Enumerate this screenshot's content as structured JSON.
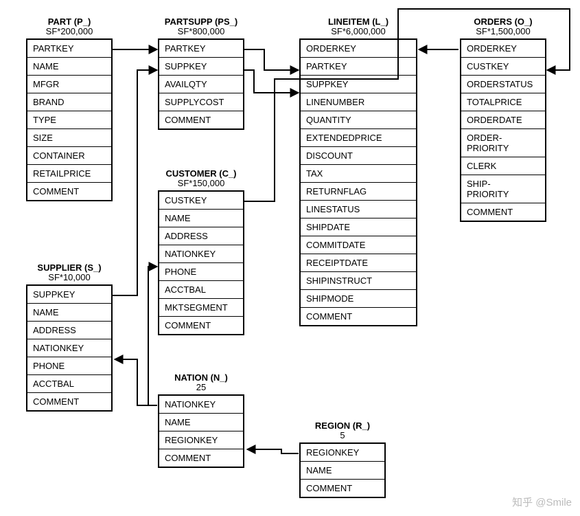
{
  "tables": {
    "part": {
      "title": "PART (P_)",
      "subtitle": "SF*200,000",
      "fields": [
        "PARTKEY",
        "NAME",
        "MFGR",
        "BRAND",
        "TYPE",
        "SIZE",
        "CONTAINER",
        "RETAILPRICE",
        "COMMENT"
      ]
    },
    "partsupp": {
      "title": "PARTSUPP (PS_)",
      "subtitle": "SF*800,000",
      "fields": [
        "PARTKEY",
        "SUPPKEY",
        "AVAILQTY",
        "SUPPLYCOST",
        "COMMENT"
      ]
    },
    "lineitem": {
      "title": "LINEITEM (L_)",
      "subtitle": "SF*6,000,000",
      "fields": [
        "ORDERKEY",
        "PARTKEY",
        "SUPPKEY",
        "LINENUMBER",
        "QUANTITY",
        "EXTENDEDPRICE",
        "DISCOUNT",
        "TAX",
        "RETURNFLAG",
        "LINESTATUS",
        "SHIPDATE",
        "COMMITDATE",
        "RECEIPTDATE",
        "SHIPINSTRUCT",
        "SHIPMODE",
        "COMMENT"
      ]
    },
    "orders": {
      "title": "ORDERS (O_)",
      "subtitle": "SF*1,500,000",
      "fields": [
        "ORDERKEY",
        "CUSTKEY",
        "ORDERSTATUS",
        "TOTALPRICE",
        "ORDERDATE",
        "ORDER-\nPRIORITY",
        "CLERK",
        "SHIP-\nPRIORITY",
        "COMMENT"
      ]
    },
    "supplier": {
      "title": "SUPPLIER (S_)",
      "subtitle": "SF*10,000",
      "fields": [
        "SUPPKEY",
        "NAME",
        "ADDRESS",
        "NATIONKEY",
        "PHONE",
        "ACCTBAL",
        "COMMENT"
      ]
    },
    "customer": {
      "title": "CUSTOMER (C_)",
      "subtitle": "SF*150,000",
      "fields": [
        "CUSTKEY",
        "NAME",
        "ADDRESS",
        "NATIONKEY",
        "PHONE",
        "ACCTBAL",
        "MKTSEGMENT",
        "COMMENT"
      ]
    },
    "nation": {
      "title": "NATION (N_)",
      "subtitle": "25",
      "fields": [
        "NATIONKEY",
        "NAME",
        "REGIONKEY",
        "COMMENT"
      ]
    },
    "region": {
      "title": "REGION (R_)",
      "subtitle": "5",
      "fields": [
        "REGIONKEY",
        "NAME",
        "COMMENT"
      ]
    }
  },
  "relationships": [
    {
      "from": "PART.PARTKEY",
      "to": "PARTSUPP.PARTKEY"
    },
    {
      "from": "SUPPLIER.SUPPKEY",
      "to": "PARTSUPP.SUPPKEY"
    },
    {
      "from": "PARTSUPP.PARTKEY",
      "to": "LINEITEM.PARTKEY"
    },
    {
      "from": "PARTSUPP.SUPPKEY",
      "to": "LINEITEM.SUPPKEY"
    },
    {
      "from": "CUSTOMER.CUSTKEY",
      "to": "ORDERS.CUSTKEY"
    },
    {
      "from": "ORDERS.ORDERKEY",
      "to": "LINEITEM.ORDERKEY"
    },
    {
      "from": "NATION.NATIONKEY",
      "to": "SUPPLIER.NATIONKEY"
    },
    {
      "from": "NATION.NATIONKEY",
      "to": "CUSTOMER.NATIONKEY"
    },
    {
      "from": "REGION.REGIONKEY",
      "to": "NATION.REGIONKEY"
    }
  ],
  "watermark": "知乎 @Smile"
}
